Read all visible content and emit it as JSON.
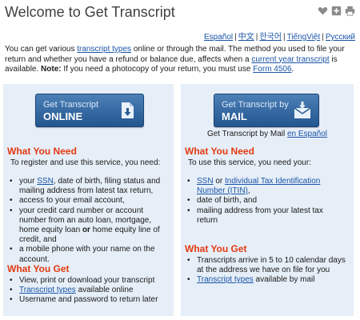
{
  "header": {
    "title": "Welcome to Get Transcript",
    "icons": [
      "heart-icon",
      "plus-icon",
      "print-icon"
    ]
  },
  "languages": [
    "Español",
    "中文",
    "한국어",
    "TiếngViệt",
    "Русский"
  ],
  "intro": {
    "t1": "You can get various ",
    "link1": "transcript types",
    "t2": " online or through the mail. The method you used to file your return and whether you have a refund or balance due, affects when a ",
    "link2": "current year transcript",
    "t3": " is available. ",
    "note_label": "Note:",
    "t4": " If you need a photocopy of your return, you must use ",
    "link3": "Form 4506",
    "t5": "."
  },
  "online": {
    "button_line1": "Get Transcript",
    "button_line2": "ONLINE",
    "need_heading": "What You Need",
    "need_intro": "To register and use this service, you need:",
    "need_items": [
      {
        "pre": "your ",
        "link": "SSN",
        "post": ", date of birth, filing status and mailing address from latest tax return,"
      },
      {
        "pre": "access to your email account,",
        "link": "",
        "post": ""
      },
      {
        "pre": "your credit card number or account number from an auto loan, mortgage, home equity loan ",
        "bold": "or",
        "post": " home equity line of credit, and"
      },
      {
        "pre": "a mobile phone with your name on the account.",
        "link": "",
        "post": ""
      }
    ],
    "get_heading": "What You Get",
    "get_items": [
      {
        "pre": "View, print or download your transcript",
        "link": "",
        "post": ""
      },
      {
        "pre": "",
        "link": "Transcript types",
        "post": " available online"
      },
      {
        "pre": "Username and password to return later",
        "link": "",
        "post": ""
      }
    ]
  },
  "mail": {
    "button_line1": "Get Transcript by",
    "button_line2": "MAIL",
    "note_text": "Get Transcript by Mail ",
    "note_link": "en Español",
    "need_heading": "What You Need",
    "need_intro": "To use this service, you need your:",
    "need_items": [
      {
        "pre": "",
        "link": "SSN",
        "mid": " or ",
        "link2": "Individual Tax Identification Number (ITIN)",
        "post": ","
      },
      {
        "pre": "date of birth, and",
        "link": "",
        "post": ""
      },
      {
        "pre": "mailing address from your latest tax return",
        "link": "",
        "post": ""
      }
    ],
    "get_heading": "What You Get",
    "get_items": [
      {
        "pre": "Transcripts arrive in 5 to 10 calendar days at the  address we have on file for you",
        "link": "",
        "post": ""
      },
      {
        "pre": "",
        "link": "Transcript types",
        "post": " available by mail"
      }
    ]
  },
  "colors": {
    "heading_red": "#e33a12",
    "panel_bg": "#e6eef7",
    "button_blue": "#24558f",
    "link_blue": "#1a55a8"
  }
}
